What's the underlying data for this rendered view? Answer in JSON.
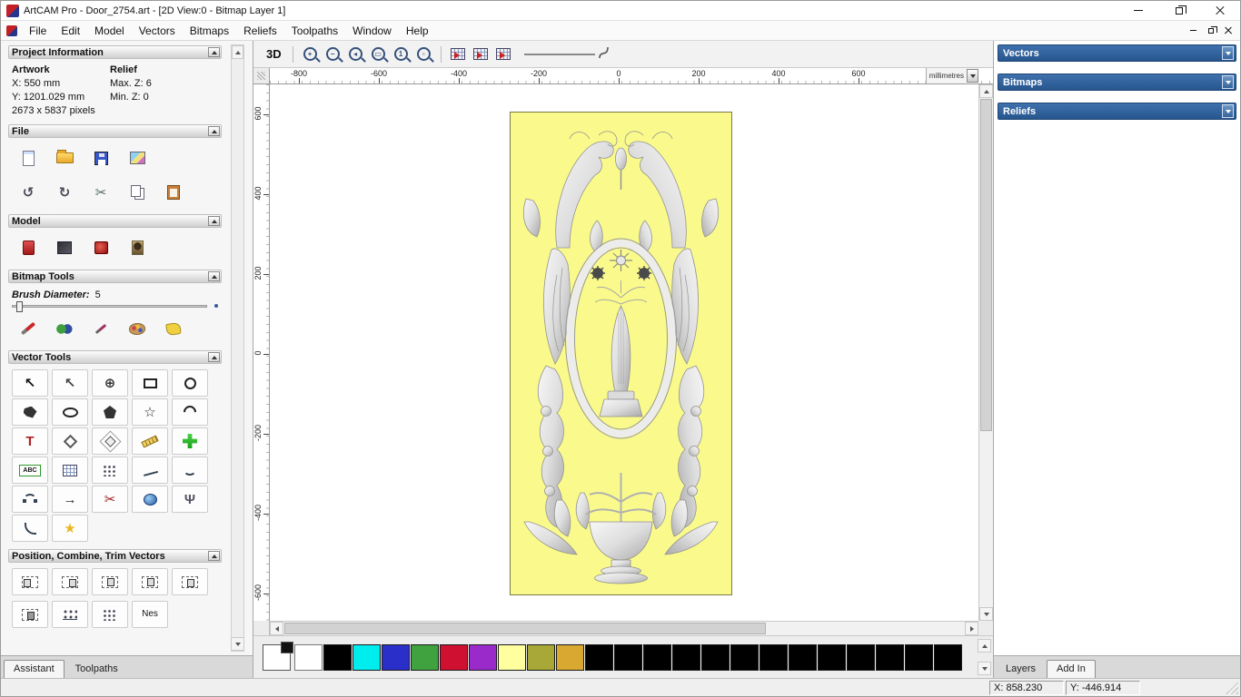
{
  "title_bar": {
    "app_title": "ArtCAM Pro - Door_2754.art - [2D View:0 - Bitmap Layer 1]"
  },
  "menu_bar": {
    "items": [
      "File",
      "Edit",
      "Model",
      "Vectors",
      "Bitmaps",
      "Reliefs",
      "Toolpaths",
      "Window",
      "Help"
    ]
  },
  "assistant_panel": {
    "project_information": {
      "title": "Project Information",
      "artwork_header": "Artwork",
      "relief_header": "Relief",
      "artwork_x": "X: 550 mm",
      "artwork_y": "Y: 1201.029 mm",
      "artwork_pixels": "2673 x 5837 pixels",
      "relief_max_z": "Max. Z: 6",
      "relief_min_z": "Min. Z: 0"
    },
    "file_section": {
      "title": "File",
      "row1": [
        {
          "name": "new-model-icon",
          "shape": "s-page"
        },
        {
          "name": "open-file-icon",
          "shape": "s-folder"
        },
        {
          "name": "save-model-icon",
          "shape": "s-floppy"
        },
        {
          "name": "export-image-icon",
          "shape": "s-image"
        }
      ],
      "row2": [
        {
          "name": "undo-icon",
          "glyph": "↺",
          "color": "#4a4a58"
        },
        {
          "name": "redo-icon",
          "glyph": "↻",
          "color": "#4a4a58"
        },
        {
          "name": "cut-icon",
          "glyph": "✂",
          "color": "#566"
        },
        {
          "name": "copy-icon",
          "shape": "s-copy"
        },
        {
          "name": "paste-icon",
          "shape": "s-paste"
        }
      ]
    },
    "model_section": {
      "title": "Model",
      "tools": [
        {
          "name": "set-model-size-icon",
          "shape": "s-model"
        },
        {
          "name": "adjust-lighting-icon",
          "shape": "s-dark"
        },
        {
          "name": "stamp-relief-icon",
          "shape": "s-stamp"
        },
        {
          "name": "greyscale-preview-icon",
          "shape": "s-portrait"
        }
      ]
    },
    "bitmap_tools": {
      "title": "Bitmap Tools",
      "brush_label": "Brush Diameter:",
      "brush_value": "5",
      "tools": [
        {
          "name": "paint-brush-icon",
          "shape": "s-brush"
        },
        {
          "name": "colour-blend-icon",
          "shape": "s-blend"
        },
        {
          "name": "touch-up-brush-icon",
          "shape": "s-smallbrush"
        },
        {
          "name": "colour-palette-icon",
          "shape": "s-palette"
        },
        {
          "name": "flood-fill-icon",
          "shape": "s-fill"
        }
      ]
    },
    "vector_tools": {
      "title": "Vector Tools",
      "tools": [
        {
          "name": "select-vectors-icon",
          "glyph": "↖",
          "color": "#111"
        },
        {
          "name": "node-editing-icon",
          "glyph": "↖",
          "color": "#444"
        },
        {
          "name": "transform-vectors-icon",
          "glyph": "⊕",
          "color": "#333"
        },
        {
          "name": "create-rectangle-icon",
          "shape": "s-rect"
        },
        {
          "name": "create-circle-icon",
          "shape": "s-circle"
        },
        {
          "name": "create-freeform-icon",
          "shape": "s-free"
        },
        {
          "name": "create-ellipse-icon",
          "shape": "s-ellipse"
        },
        {
          "name": "create-polygon-icon",
          "shape": "s-pent"
        },
        {
          "name": "create-star-icon",
          "glyph": "☆",
          "color": "#222"
        },
        {
          "name": "create-arc-icon",
          "shape": "s-arc"
        },
        {
          "name": "create-text-icon",
          "glyph": "T",
          "color": "#b02020"
        },
        {
          "name": "text-on-curve-icon",
          "shape": "s-diamond"
        },
        {
          "name": "offset-vector-icon",
          "shape": "s-diamond2"
        },
        {
          "name": "measure-tool-icon",
          "shape": "s-ruler"
        },
        {
          "name": "vector-doctor-icon",
          "shape": "s-plus"
        },
        {
          "name": "vector-text-icon",
          "glyph": "ABC",
          "cls": "ti-abc"
        },
        {
          "name": "bitmap-to-vector-icon",
          "shape": "s-grid"
        },
        {
          "name": "block-copy-icon",
          "shape": "s-dots"
        },
        {
          "name": "fit-polyline-icon",
          "shape": "s-fitline"
        },
        {
          "name": "fit-arcs-icon",
          "shape": "s-fitarc"
        },
        {
          "name": "join-vectors-icon",
          "shape": "s-join"
        },
        {
          "name": "close-vector-icon",
          "glyph": "→",
          "color": "#333"
        },
        {
          "name": "trim-vectors-icon",
          "glyph": "✂",
          "color": "#a02020"
        },
        {
          "name": "extrude-vector-icon",
          "shape": "s-extrude"
        },
        {
          "name": "vector-profile-icon",
          "glyph": "Ψ",
          "color": "#556"
        },
        {
          "name": "fillet-vectors-icon",
          "shape": "s-fillet"
        },
        {
          "name": "magic-wand-icon",
          "glyph": "★",
          "color": "#e8b820"
        }
      ]
    },
    "position_section": {
      "title": "Position, Combine, Trim Vectors",
      "row1": [
        {
          "name": "align-left-icon",
          "shape": "al al-l"
        },
        {
          "name": "align-right-icon",
          "shape": "al al-r"
        },
        {
          "name": "align-top-icon",
          "shape": "al al-t"
        },
        {
          "name": "align-bottom-icon",
          "shape": "al al-b"
        },
        {
          "name": "align-centre-icon",
          "shape": "al al-c"
        }
      ],
      "row2": [
        {
          "name": "centre-in-page-icon",
          "shape": "al al-c2"
        },
        {
          "name": "paste-along-curve-icon",
          "shape": "s-dots2"
        },
        {
          "name": "block-nest-icon",
          "shape": "s-dots"
        },
        {
          "name": "nesting-icon",
          "glyph": "Nes",
          "color": "#111",
          "cls": "ti-nes"
        }
      ]
    },
    "tabs": {
      "assistant": "Assistant",
      "toolpaths": "Toolpaths"
    }
  },
  "toolbar": {
    "view_3d_label": "3D",
    "zoom_tools": [
      {
        "name": "zoom-in-icon",
        "char": "+"
      },
      {
        "name": "zoom-out-icon",
        "char": "−"
      },
      {
        "name": "zoom-previous-icon",
        "char": "◂"
      },
      {
        "name": "zoom-window-icon",
        "char": "▭"
      },
      {
        "name": "zoom-1to1-icon",
        "char": "1"
      },
      {
        "name": "zoom-objects-icon",
        "char": "▫"
      }
    ],
    "view_tools": [
      {
        "name": "toggle-bitmap-view-icon"
      },
      {
        "name": "toggle-vector-view-icon"
      },
      {
        "name": "preview-relief-layer-icon"
      }
    ]
  },
  "ruler": {
    "unit": "millimetres",
    "h_labels": [
      "-800",
      "-600",
      "-400",
      "-200",
      "0",
      "200",
      "400",
      "600"
    ],
    "v_labels": [
      "600",
      "400",
      "200",
      "0",
      "-200",
      "-400",
      "-600"
    ]
  },
  "right_panel": {
    "vectors_title": "Vectors",
    "bitmaps_title": "Bitmaps",
    "reliefs_title": "Reliefs",
    "layers_tab": "Layers",
    "addin_tab": "Add In"
  },
  "palette": {
    "swatches": [
      "#ffffff",
      "#000000",
      "#00eded",
      "#2b2fca",
      "#3fa23f",
      "#cf1030",
      "#9a2bca",
      "#ffffa0",
      "#a8a838",
      "#d8a830",
      "#000000",
      "#000000",
      "#000000",
      "#000000",
      "#000000",
      "#000000",
      "#000000",
      "#000000",
      "#000000",
      "#000000",
      "#000000",
      "#000000",
      "#000000"
    ]
  },
  "status_bar": {
    "x_coord": "X: 858.230",
    "y_coord": "Y: -446.914"
  }
}
